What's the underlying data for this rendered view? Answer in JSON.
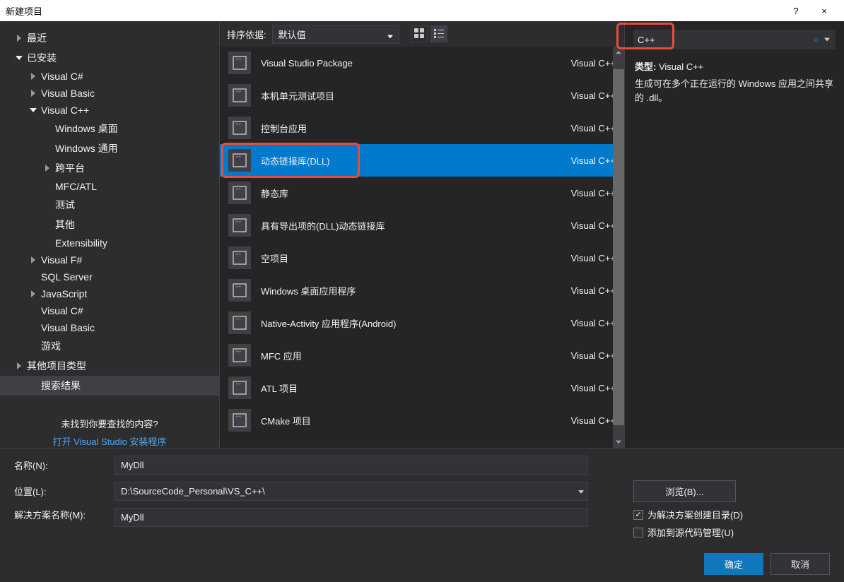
{
  "titlebar": {
    "title": "新建项目",
    "help": "?",
    "close": "×"
  },
  "sidebar": {
    "recent": "最近",
    "installed": "已安装",
    "nodes": {
      "vcs": "Visual C#",
      "vb": "Visual Basic",
      "vcpp": "Visual C++",
      "win_desktop": "Windows 桌面",
      "win_universal": "Windows 通用",
      "cross": "跨平台",
      "mfc": "MFC/ATL",
      "test": "测试",
      "other": "其他",
      "ext": "Extensibility",
      "vfs": "Visual F#",
      "sql": "SQL Server",
      "js": "JavaScript",
      "vcs2": "Visual C#",
      "vb2": "Visual Basic",
      "game": "游戏",
      "other_types": "其他项目类型",
      "search_results": "搜索结果"
    },
    "help_text": "未找到你要查找的内容?",
    "installer_link": "打开 Visual Studio 安装程序"
  },
  "center": {
    "sort_label": "排序依据:",
    "sort_value": "默认值",
    "templates": [
      {
        "name": "Visual Studio Package",
        "lang": "Visual C++"
      },
      {
        "name": "本机单元测试项目",
        "lang": "Visual C++"
      },
      {
        "name": "控制台应用",
        "lang": "Visual C++"
      },
      {
        "name": "动态链接库(DLL)",
        "lang": "Visual C++"
      },
      {
        "name": "静态库",
        "lang": "Visual C++"
      },
      {
        "name": "具有导出项的(DLL)动态链接库",
        "lang": "Visual C++"
      },
      {
        "name": "空项目",
        "lang": "Visual C++"
      },
      {
        "name": "Windows 桌面应用程序",
        "lang": "Visual C++"
      },
      {
        "name": "Native-Activity 应用程序(Android)",
        "lang": "Visual C++"
      },
      {
        "name": "MFC 应用",
        "lang": "Visual C++"
      },
      {
        "name": "ATL 项目",
        "lang": "Visual C++"
      },
      {
        "name": "CMake 项目",
        "lang": "Visual C++"
      }
    ],
    "selected_index": 3
  },
  "right": {
    "search_value": "C++",
    "type_label": "类型:",
    "type_value": "Visual C++",
    "description": "生成可在多个正在运行的 Windows 应用之间共享的 .dll。"
  },
  "bottom": {
    "name_label": "名称(N):",
    "name_value": "MyDll",
    "location_label": "位置(L):",
    "location_value": "D:\\SourceCode_Personal\\VS_C++\\",
    "browse_label": "浏览(B)...",
    "solution_label": "解决方案名称(M):",
    "solution_value": "MyDll",
    "create_dir_label": "为解决方案创建目录(D)",
    "add_scm_label": "添加到源代码管理(U)",
    "ok_label": "确定",
    "cancel_label": "取消"
  }
}
